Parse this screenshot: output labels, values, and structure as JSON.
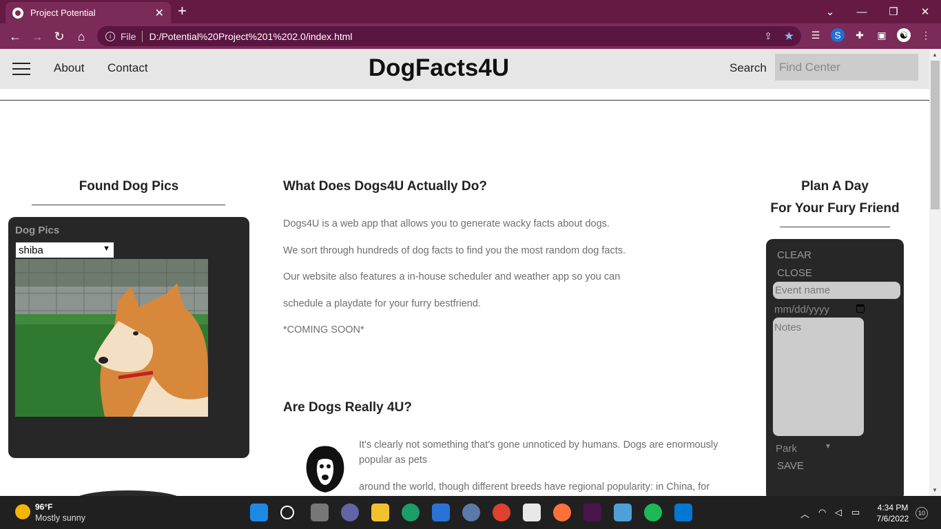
{
  "browser": {
    "tab_title": "Project Potential",
    "tab_close": "✕",
    "new_tab": "+",
    "file_label": "File",
    "url": "D:/Potential%20Project%201%202.0/index.html"
  },
  "header": {
    "brand": "DogFacts4U",
    "nav": {
      "about": "About",
      "contact": "Contact"
    },
    "search_label": "Search",
    "search_placeholder": "Find Center"
  },
  "left": {
    "title": "Found Dog Pics",
    "card_label": "Dog Pics",
    "breed_selected": "shiba"
  },
  "main": {
    "heading1": "What Does Dogs4U Actually Do?",
    "paragraphs": [
      "Dogs4U is a web app that allows you to generate wacky facts about dogs.",
      "We sort through hundreds of dog facts to find you the most random dog facts.",
      "Our website also features a in-house scheduler and weather app so you can",
      "schedule a playdate for your furry bestfriend.",
      "*COMING SOON*"
    ],
    "heading2": "Are Dogs Really 4U?",
    "para2": [
      "It's clearly not something that's gone unnoticed by humans. Dogs are enormously",
      "popular as pets",
      "around the world, though different breeds have regional popularity: in China, for"
    ]
  },
  "right": {
    "title_line1": "Plan A Day",
    "title_line2": "For Your Fury Friend",
    "clear": "CLEAR",
    "close": "CLOSE",
    "event_placeholder": "Event name",
    "date_placeholder": "mm/dd/yyyy",
    "notes_placeholder": "Notes",
    "place_selected": "Park",
    "save": "SAVE"
  },
  "taskbar": {
    "temp": "96°F",
    "weather": "Mostly sunny",
    "time": "4:34 PM",
    "date": "7/6/2022",
    "notifications": "10"
  },
  "icons": [
    "back-icon",
    "forward-icon",
    "reload-icon",
    "home-icon",
    "info-icon",
    "share-icon",
    "star-icon",
    "puzzle-icon",
    "sidebar-icon",
    "hamburger-icon",
    "chevron-down-icon",
    "calendar-icon"
  ]
}
